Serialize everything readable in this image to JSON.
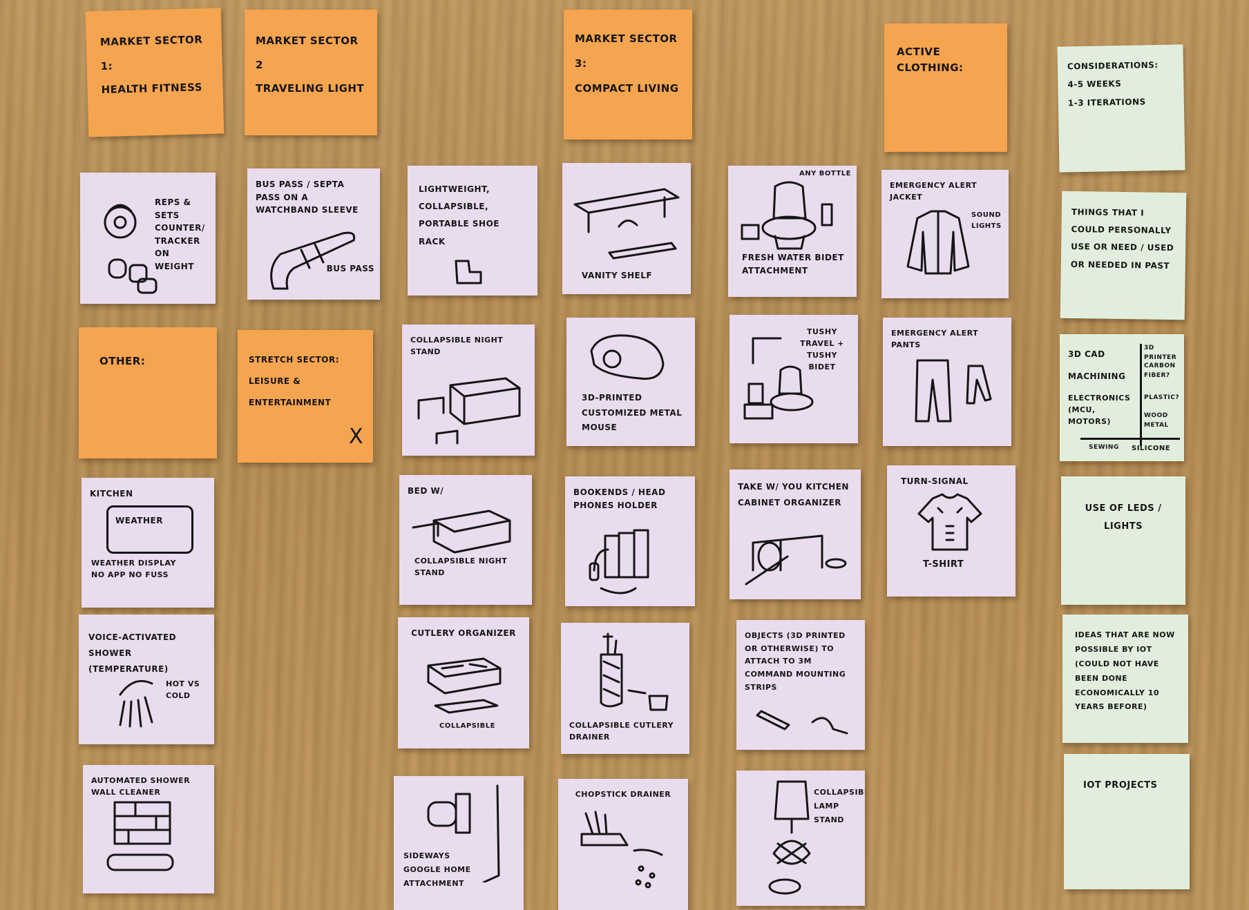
{
  "notes": {
    "n1": "MARKET SECTOR 1:\nHEALTH FITNESS",
    "n2": "MARKET SECTOR 2\nTRAVELING LIGHT",
    "n3": "MARKET SECTOR 3:\nCOMPACT LIVING",
    "n4": "ACTIVE CLOTHING:",
    "n5": "CONSIDERATIONS:\n4-5 WEEKS\n1-3 ITERATIONS",
    "n6": "REPS & SETS COUNTER/ TRACKER ON WEIGHT",
    "n7": "BUS PASS / SEPTA PASS ON A WATCHBAND SLEEVE",
    "n7b": "BUS PASS",
    "n8": "LIGHTWEIGHT, COLLAPSIBLE, PORTABLE SHOE RACK",
    "n9": "VANITY SHELF",
    "n10": "ANY BOTTLE",
    "n10b": "FRESH WATER BIDET ATTACHMENT",
    "n11": "EMERGENCY ALERT JACKET",
    "n11b": "SOUND LIGHTS",
    "n12": "THINGS THAT I COULD PERSONALLY USE OR NEED / USED OR NEEDED IN PAST",
    "n13": "OTHER:",
    "n14": "STRETCH SECTOR:\nLEISURE &\nENTERTAINMENT",
    "n14x": "X",
    "n15": "COLLAPSIBLE NIGHT STAND",
    "n16": "3D-PRINTED CUSTOMIZED METAL MOUSE",
    "n17": "TUSHY TRAVEL + TUSHY BIDET",
    "n18": "EMERGENCY ALERT PANTS",
    "n19a": "3D CAD",
    "n19b": "MACHINING",
    "n19c": "ELECTRONICS (MCU, MOTORS)",
    "n19d": "3D PRINTER",
    "n19e": "CARBON FIBER?",
    "n19f": "PLASTIC?",
    "n19g": "WOOD METAL",
    "n19h": "SEWING",
    "n19i": "SILICONE",
    "n20": "KITCHEN",
    "n20b": "WEATHER",
    "n20c": "WEATHER DISPLAY NO APP NO FUSS",
    "n21": "BED W/",
    "n21b": "COLLAPSIBLE NIGHT STAND",
    "n22": "BOOKENDS / HEAD PHONES HOLDER",
    "n23": "TAKE W/ YOU KITCHEN CABINET ORGANIZER",
    "n24": "TURN-SIGNAL",
    "n24b": "T-SHIRT",
    "n25": "USE OF LEDS / LIGHTS",
    "n26": "VOICE-ACTIVATED SHOWER (TEMPERATURE)",
    "n26b": "HOT VS COLD",
    "n27": "CUTLERY ORGANIZER",
    "n27b": "COLLAPSIBLE",
    "n28": "COLLAPSIBLE CUTLERY DRAINER",
    "n29": "OBJECTS (3D PRINTED OR OTHERWISE) TO ATTACH TO 3M COMMAND MOUNTING STRIPS",
    "n30": "IDEAS THAT ARE NOW POSSIBLE BY IOT (COULD NOT HAVE BEEN DONE ECONOMICALLY 10 YEARS BEFORE)",
    "n31": "AUTOMATED SHOWER WALL CLEANER",
    "n32": "SIDEWAYS GOOGLE HOME ATTACHMENT",
    "n33": "CHOPSTICK DRAINER",
    "n34": "COLLAPSIBLE LAMP STAND",
    "n35": "IOT PROJECTS"
  },
  "colors": {
    "board": "#b68d55",
    "orange_note": "#f5a44f",
    "pink_note": "#e9dcef",
    "green_note": "#e2eedd",
    "ink": "#151515"
  }
}
